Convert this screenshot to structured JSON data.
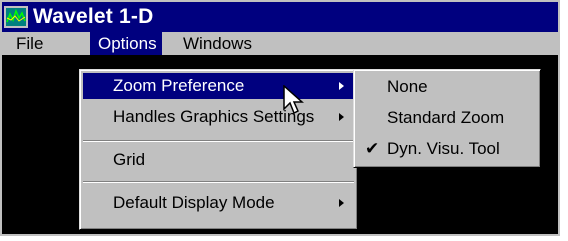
{
  "window": {
    "title": "Wavelet 1-D",
    "icon": "wavelet-app-icon"
  },
  "menubar": {
    "items": [
      {
        "label": "File"
      },
      {
        "label": "Options"
      },
      {
        "label": "Windows"
      }
    ],
    "active": "Options"
  },
  "options_menu": {
    "items": [
      {
        "label": "Zoom Preference",
        "submenu": true,
        "highlighted": true
      },
      {
        "label": "Handles Graphics Settings",
        "submenu": true
      },
      {
        "label": "Grid",
        "submenu": false
      },
      {
        "label": "Default Display Mode",
        "submenu": true
      }
    ]
  },
  "zoom_submenu": {
    "items": [
      {
        "label": "None",
        "checked": false
      },
      {
        "label": "Standard Zoom",
        "checked": false
      },
      {
        "label": "Dyn. Visu. Tool",
        "checked": true
      }
    ],
    "check_glyph": "✔"
  },
  "colors": {
    "title_bar": "#00007f",
    "menu_face": "#c0c0c0",
    "highlight": "#00007f",
    "workspace": "#000000"
  }
}
